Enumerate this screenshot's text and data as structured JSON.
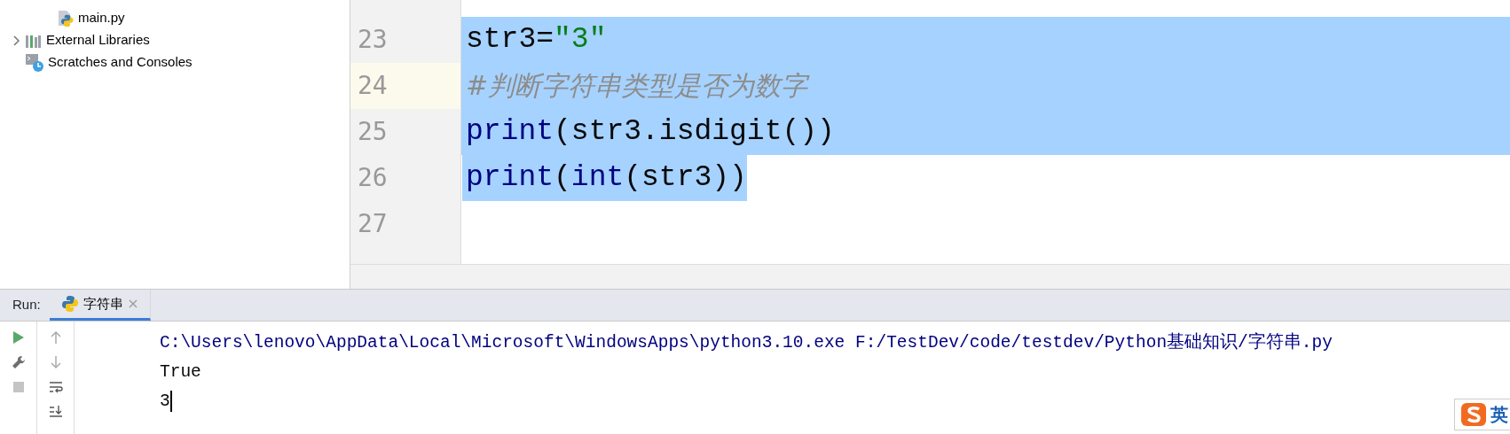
{
  "project_tree": {
    "items": [
      {
        "children": [
          {
            "label": "main.py",
            "kind": "python-file"
          }
        ]
      },
      {
        "label": "External Libraries",
        "kind": "libraries",
        "expanded": false
      },
      {
        "label": "Scratches and Consoles",
        "kind": "scratches"
      }
    ]
  },
  "editor": {
    "lines": [
      {
        "number": "23",
        "current": false,
        "selected": true,
        "selected_to_edge": true,
        "tokens": [
          {
            "text": "str3=",
            "kind": "plain"
          },
          {
            "text": "\"3\"",
            "kind": "string"
          }
        ]
      },
      {
        "number": "24",
        "current": true,
        "selected": true,
        "selected_to_edge": true,
        "tokens": [
          {
            "text": "#判断字符串类型是否为数字",
            "kind": "comment"
          }
        ]
      },
      {
        "number": "25",
        "current": false,
        "selected": true,
        "selected_to_edge": true,
        "tokens": [
          {
            "text": "print",
            "kind": "builtin"
          },
          {
            "text": "(str3.isdigit())",
            "kind": "plain"
          }
        ]
      },
      {
        "number": "26",
        "current": false,
        "selected": true,
        "selected_to_edge": false,
        "tokens": [
          {
            "text": "print",
            "kind": "builtin"
          },
          {
            "text": "(",
            "kind": "plain"
          },
          {
            "text": "int",
            "kind": "builtin"
          },
          {
            "text": "(str3))",
            "kind": "plain"
          }
        ]
      },
      {
        "number": "27",
        "current": false,
        "selected": false
      }
    ]
  },
  "run_panel": {
    "label": "Run:",
    "tabs": [
      {
        "label": "字符串",
        "selected": true
      }
    ],
    "console": [
      {
        "text": "C:\\Users\\lenovo\\AppData\\Local\\Microsoft\\WindowsApps\\python3.10.exe F:/TestDev/code/testdev/Python基础知识/字符串.py",
        "kind": "command"
      },
      {
        "text": "True",
        "kind": "output"
      },
      {
        "text": "3",
        "kind": "output"
      }
    ]
  },
  "ime_indicator": {
    "label": "英"
  }
}
